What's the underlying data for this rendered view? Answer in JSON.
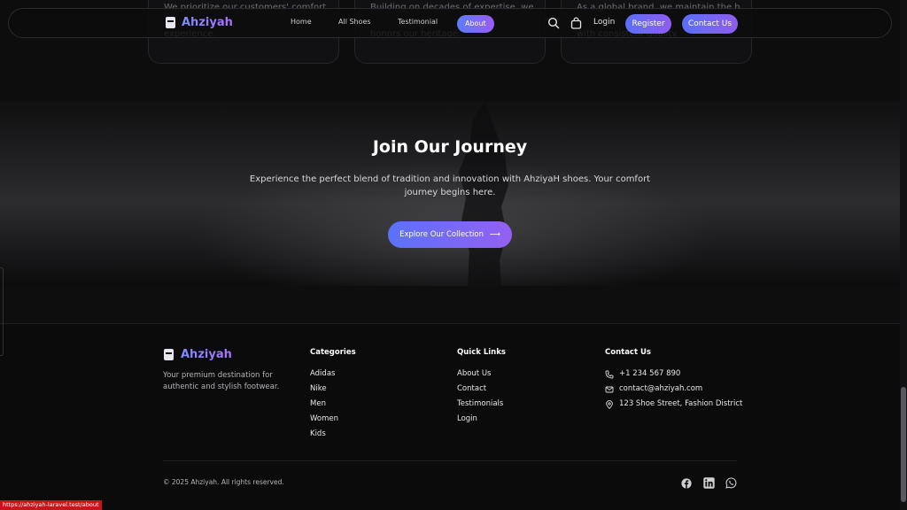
{
  "cards": [
    {
      "line1": "We prioritize our customers' comfort and",
      "line3": "experience."
    },
    {
      "line1": "Building on decades of expertise, we blend",
      "line3": "honors our heritage."
    },
    {
      "line1": "As a global brand, we maintain the highest",
      "line3": "with consistent quality."
    }
  ],
  "navbar": {
    "brand": "Ahziyah",
    "links": [
      "Home",
      "All Shoes",
      "Testimonial",
      "About"
    ],
    "active": "About",
    "login": "Login",
    "register": "Register",
    "contact": "Contact Us",
    "accent": "#6b6ff6"
  },
  "journey": {
    "title": "Join Our Journey",
    "subtitle": "Experience the perfect blend of tradition and innovation with AhziyaH shoes. Your comfort journey begins here.",
    "button": "Explore Our Collection",
    "button_arrow": "⟶"
  },
  "footer": {
    "brand": "Ahziyah",
    "tagline": "Your premium destination for authentic and stylish footwear.",
    "categories": {
      "title": "Categories",
      "items": [
        "Adidas",
        "Nike",
        "Men",
        "Women",
        "Kids"
      ]
    },
    "quick_links": {
      "title": "Quick Links",
      "items": [
        "About Us",
        "Contact",
        "Testimonials",
        "Login"
      ]
    },
    "contact": {
      "title": "Contact Us",
      "phone": "+1 234 567 890",
      "email": "contact@ahziyah.com",
      "address": "123 Shoe Street, Fashion District"
    },
    "copyright": "© 2025 Ahziyah. All rights reserved.",
    "social_icons": [
      "facebook-icon",
      "linkedin-icon",
      "whatsapp-icon"
    ]
  },
  "status_bar": {
    "url": "https://ahziyah-laravel.test/about"
  }
}
